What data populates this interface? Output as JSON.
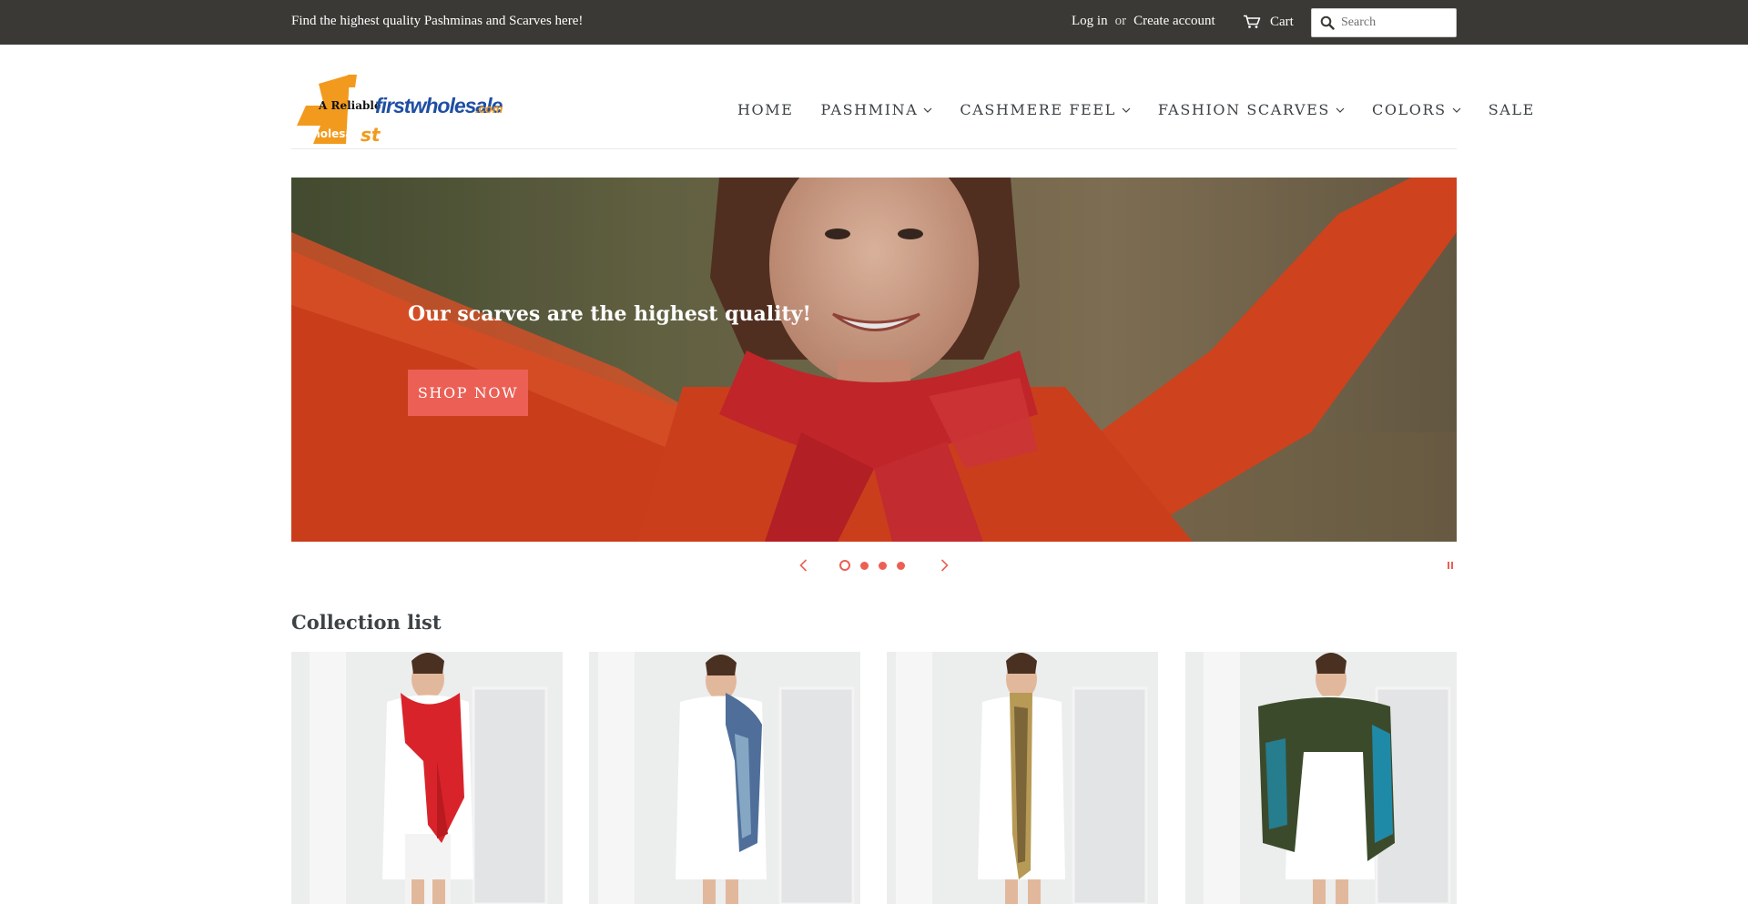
{
  "topbar": {
    "tagline": "Find the highest quality Pashminas and Scarves here!",
    "login": "Log in",
    "or": "or",
    "create_account": "Create account",
    "cart": "Cart",
    "search_placeholder": "Search"
  },
  "logo": {
    "text_reliable": "A Reliable",
    "text_brand": "firstwholesale",
    "text_domain": ".com",
    "text_wholesaler": "Wholesaler",
    "text_st": "st",
    "text_one": "1"
  },
  "nav": {
    "items": [
      {
        "label": "HOME",
        "has_dropdown": false
      },
      {
        "label": "PASHMINA",
        "has_dropdown": true
      },
      {
        "label": "CASHMERE FEEL",
        "has_dropdown": true
      },
      {
        "label": "FASHION SCARVES",
        "has_dropdown": true
      },
      {
        "label": "COLORS",
        "has_dropdown": true
      },
      {
        "label": "SALE",
        "has_dropdown": false
      }
    ]
  },
  "hero": {
    "headline": "Our scarves are the highest quality!",
    "button_label": "SHOP NOW",
    "slide_count": 4,
    "active_slide": 1
  },
  "collection": {
    "title": "Collection list",
    "cards": [
      {
        "scarf_color": "#d8232a",
        "scarf_accent": "#b81a20"
      },
      {
        "scarf_color": "#4f6f9a",
        "scarf_accent": "#86a7c4"
      },
      {
        "scarf_color": "#b79a55",
        "scarf_accent": "#4a3a22"
      },
      {
        "scarf_color": "#3c4a2c",
        "scarf_accent": "#1f8aa8"
      }
    ]
  },
  "colors": {
    "topbar_bg": "#3a3935",
    "accent": "#ec5f55",
    "text": "#3d4246",
    "logo_orange": "#f29a1d",
    "logo_blue": "#1f4ea3"
  }
}
